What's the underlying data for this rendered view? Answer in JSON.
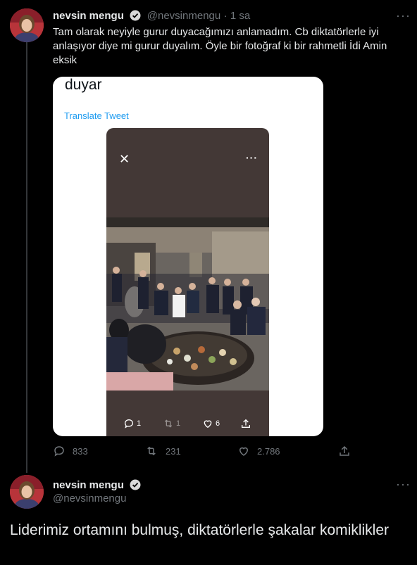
{
  "tweet1": {
    "name": "nevsin mengu",
    "handle": "@nevsinmengu",
    "time": "· 1 sa",
    "text": "Tam olarak neyiyle gurur duyacağımızı anlamadım. Cb diktatörlerle iyi anlaşıyor diye mi gurur duyalım. Öyle bir fotoğraf ki bir rahmetli İdi Amin eksik",
    "embedded": {
      "top_word": "duyar",
      "translate": "Translate Tweet",
      "replies": "1",
      "retweets": "1",
      "likes": "6"
    },
    "stats": {
      "replies": "833",
      "retweets": "231",
      "likes": "2.786"
    }
  },
  "tweet2": {
    "name": "nevsin mengu",
    "handle": "@nevsinmengu",
    "text": "Liderimiz ortamını bulmuş, diktatörlerle şakalar komiklikler"
  },
  "colors": {
    "background": "#000000",
    "text": "#e7e9ea",
    "muted": "#71767b",
    "verified": "#d9d9d9",
    "link": "#1d9bf0",
    "thread_line": "#333639"
  }
}
